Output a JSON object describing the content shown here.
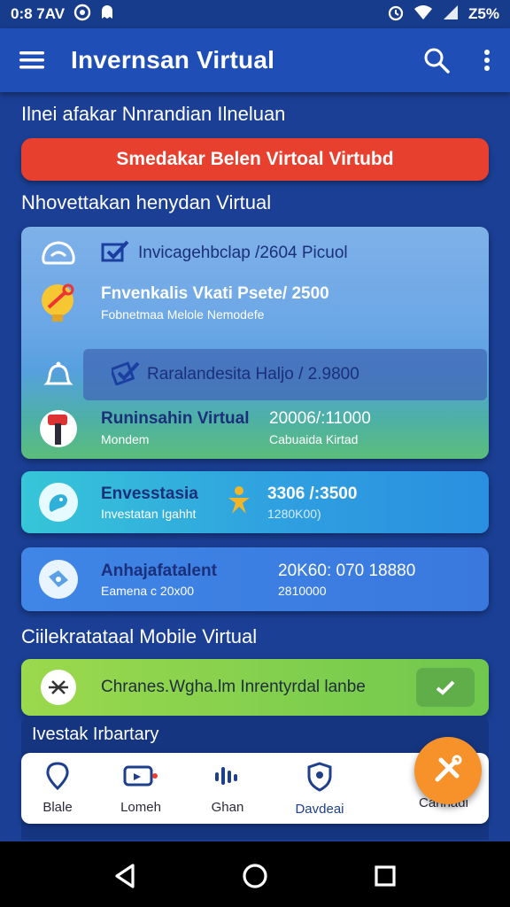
{
  "status_bar": {
    "time": "0:8 7AV",
    "battery": "Z5%"
  },
  "app_bar": {
    "title": "Invernsan Virtual"
  },
  "content": {
    "heading1": "Ilnei afakar Nnrandian Ilneluan",
    "alert_button": "Smedakar Belen Virtoal Virtubd",
    "heading2": "Nhovettakan henydan Virtual",
    "big_card": {
      "rows": [
        {
          "title": "Invicagehbclap /2604  Picuol",
          "icon": "cloud-icon"
        },
        {
          "title": "Fnvenkalis Vkati  Psete/ 2500",
          "subtitle": "Fobnetmaa Melole Nemodefe",
          "icon": "wrench-bulb-icon"
        },
        {
          "title": "Raralandesita Haljo / 2.9800",
          "icon": "bell-icon"
        },
        {
          "title": "Runinsahin Virtual",
          "value": "20006/:11000",
          "subtitle": "Mondem",
          "value_sub": "Cabuaida Kirtad",
          "icon": "hammer-icon"
        }
      ]
    },
    "card_investasia": {
      "title": "Envesstasia",
      "subtitle": "Investatan Igahht",
      "value": "3306 /:3500",
      "value_sub": "1280K00)"
    },
    "card_anhaja": {
      "title": "Anhajafatalent",
      "subtitle": "Eamena c 20x00",
      "value": "20K60: 070 18880",
      "value_sub": "2810000"
    },
    "heading3": "Ciilekratataal Mobile Virtual",
    "green_card": {
      "text": "Chranes.Wgha.lm Inrentyrdal lanbe"
    },
    "heading4": "Ivestak Irbartary"
  },
  "bottom_nav": {
    "items": [
      {
        "label": "Blale",
        "icon": "location-icon"
      },
      {
        "label": "Lomeh",
        "icon": "video-icon"
      },
      {
        "label": "Ghan",
        "icon": "signal-icon"
      },
      {
        "label": "Davdeai",
        "icon": "shield-location-icon"
      },
      {
        "label": "Cahhadi",
        "icon": "tools-icon"
      }
    ]
  },
  "colors": {
    "background": "#1a3f94",
    "app_bar": "#1f4fb6",
    "alert": "#e8402f",
    "fab": "#f7922a",
    "accent_dark_text": "#1b2f7a"
  }
}
